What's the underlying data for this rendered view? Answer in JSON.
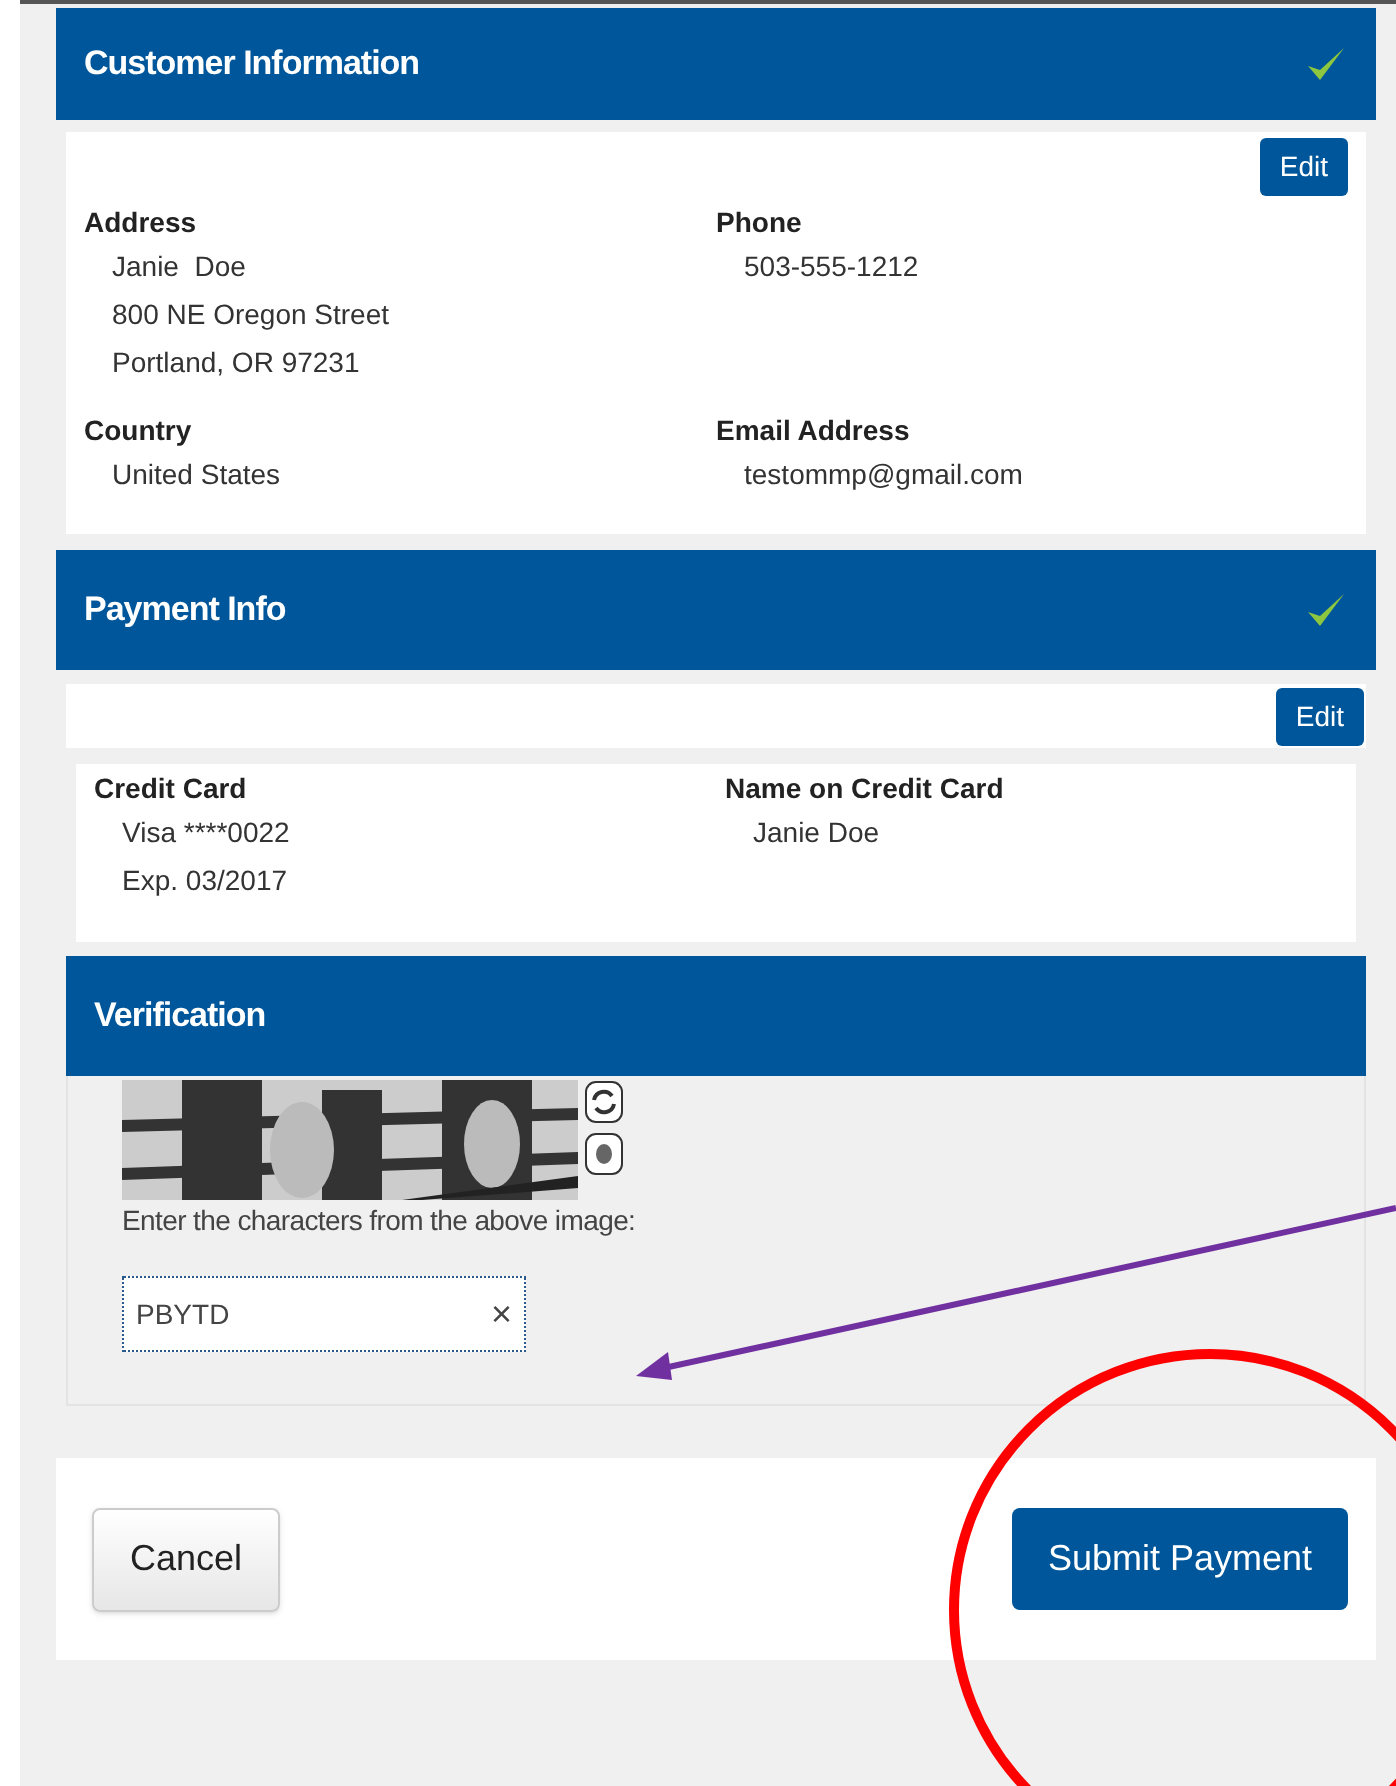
{
  "customer": {
    "title": "Customer Information",
    "completed": true,
    "edit_button": "Edit",
    "fields": [
      {
        "label": "Address",
        "lines": [
          "Janie  Doe",
          "800 NE Oregon Street",
          "Portland, OR 97231"
        ]
      },
      {
        "label": "Phone",
        "lines": [
          "503-555-1212"
        ]
      },
      {
        "label": "Country",
        "lines": [
          "United States"
        ]
      },
      {
        "label": "Email Address",
        "lines": [
          "testommp@gmail.com"
        ]
      }
    ]
  },
  "payment": {
    "title": "Payment Info",
    "completed": true,
    "edit_button": "Edit",
    "fields": [
      {
        "label": "Credit Card",
        "lines": [
          "Visa ****0022",
          "Exp. 03/2017"
        ]
      },
      {
        "label": "Name on Credit Card",
        "lines": [
          "Janie Doe"
        ]
      }
    ]
  },
  "verification": {
    "title": "Verification",
    "prompt": "Enter the characters from the above image:",
    "value": "PBYTD",
    "clear": "×"
  },
  "actions": {
    "cancel": "Cancel",
    "submit": "Submit Payment"
  }
}
